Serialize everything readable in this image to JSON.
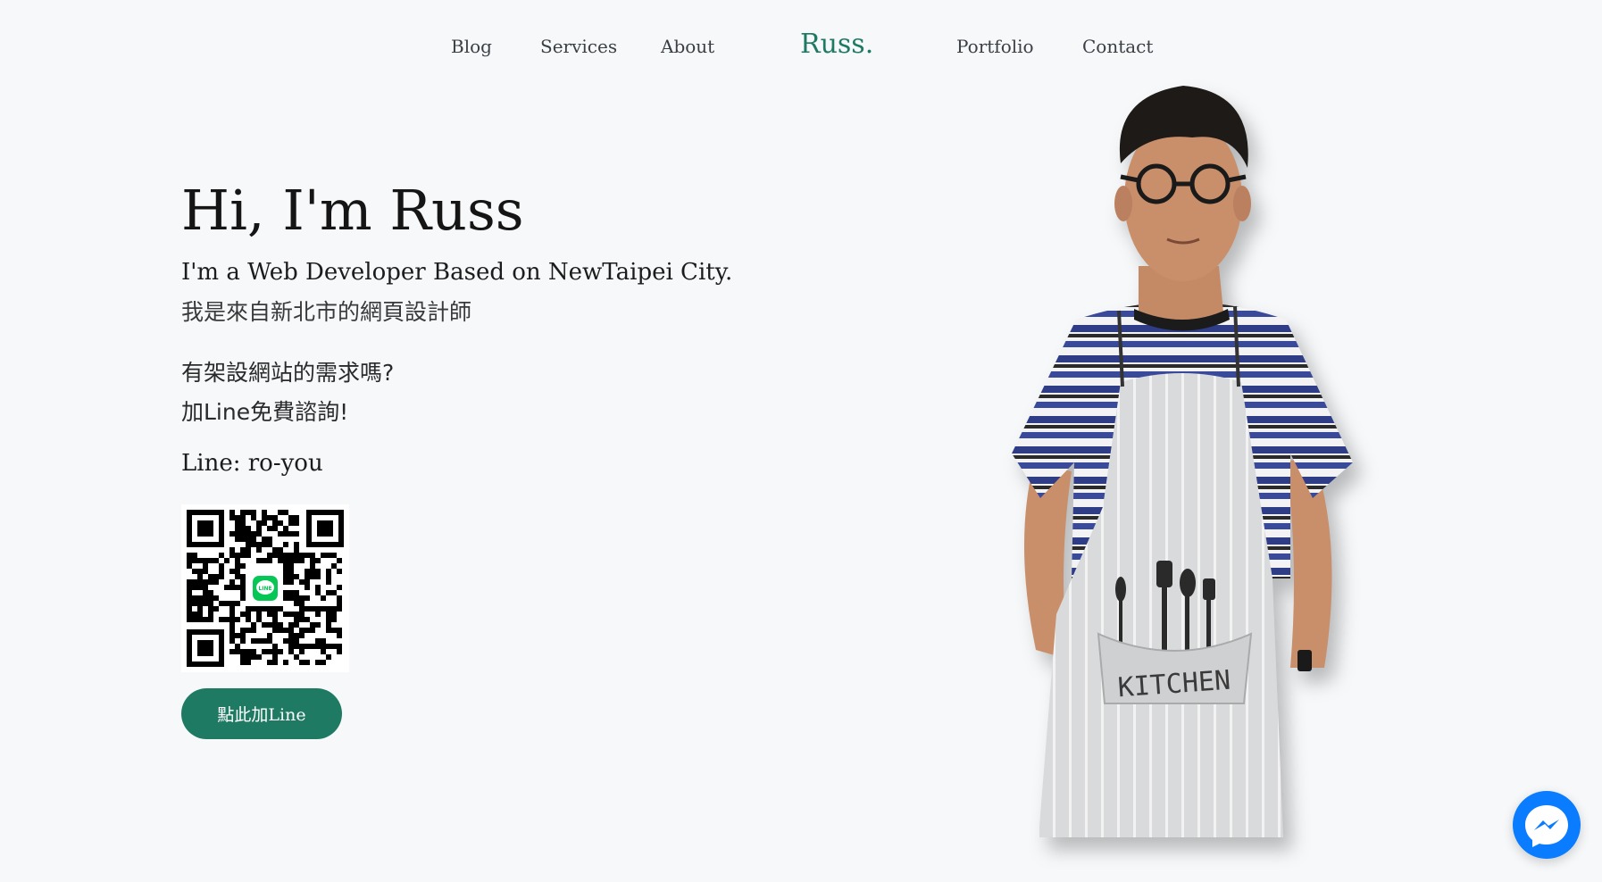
{
  "nav": {
    "items": [
      {
        "label": "Blog"
      },
      {
        "label": "Services"
      },
      {
        "label": "About"
      },
      {
        "label": "Portfolio"
      },
      {
        "label": "Contact"
      }
    ],
    "logo": "Russ."
  },
  "hero": {
    "title": "Hi, I'm Russ",
    "subtitle_en": "I'm a Web Developer Based on NewTaipei City.",
    "subtitle_zh": "我是來自新北市的網頁設計師",
    "cta_line1": "有架設網站的需求嗎?",
    "cta_line2": "加Line免費諮詢!",
    "line_id": "Line: ro-you",
    "qr_badge": "LINE",
    "button_label": "點此加Line"
  },
  "portrait": {
    "apron_text": "KITCHEN"
  },
  "colors": {
    "accent": "#1f7a63",
    "background": "#f6f8fa",
    "messenger": "#0a7cff",
    "line_green": "#06c755"
  },
  "icons": {
    "qr": "line-qr-code-icon",
    "messenger": "messenger-icon"
  }
}
